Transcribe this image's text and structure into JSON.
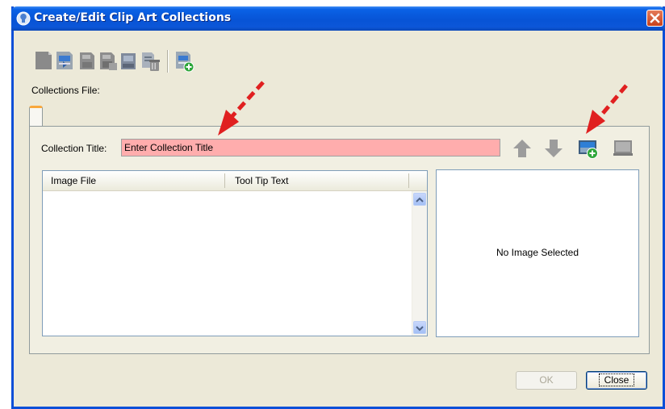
{
  "window": {
    "title": "Create/Edit Clip Art Collections",
    "close_glyph": "✕"
  },
  "toolbar": {
    "icons": [
      "new-collection-file-icon",
      "open-collection-file-icon",
      "save-icon",
      "save-as-icon",
      "close-file-icon",
      "delete-icon",
      "import-icon"
    ]
  },
  "collections_file": {
    "label": "Collections File:"
  },
  "collection_title": {
    "label": "Collection Title:",
    "value": "Enter Collection Title"
  },
  "item_buttons": [
    "move-up-icon",
    "move-down-icon",
    "add-image-icon",
    "remove-image-icon"
  ],
  "table": {
    "columns": [
      "Image File",
      "Tool Tip Text"
    ],
    "rows": []
  },
  "preview": {
    "empty_text": "No Image Selected"
  },
  "buttons": {
    "ok": "OK",
    "close": "Close"
  },
  "colors": {
    "title_field_bg": "#ffadad",
    "annotation_arrow": "#e02020",
    "titlebar": "#0a62e6"
  }
}
